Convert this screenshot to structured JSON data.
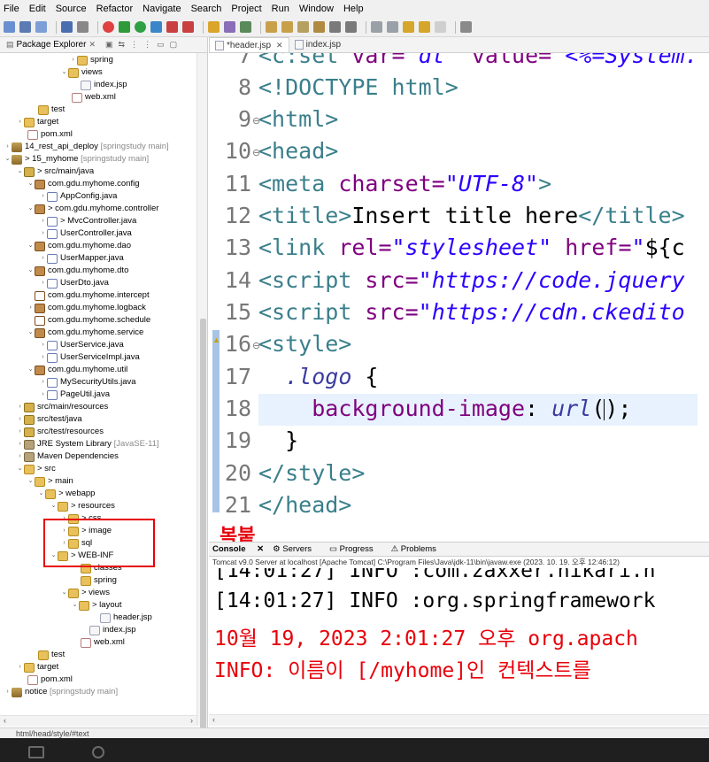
{
  "menu": [
    "File",
    "Edit",
    "Source",
    "Refactor",
    "Navigate",
    "Search",
    "Project",
    "Run",
    "Window",
    "Help"
  ],
  "explorer": {
    "tab_label": "Package Explorer",
    "rows": [
      {
        "label": "spring",
        "extra": ""
      },
      {
        "label": "views",
        "extra": ""
      },
      {
        "label": "index.jsp",
        "extra": ""
      },
      {
        "label": "web.xml",
        "extra": ""
      },
      {
        "label": "test",
        "extra": ""
      },
      {
        "label": "target",
        "extra": ""
      },
      {
        "label": "pom.xml",
        "extra": ""
      },
      {
        "label": "14_rest_api_deploy",
        "extra": "[springstudy main]"
      },
      {
        "label": "> 15_myhome",
        "extra": "[springstudy main]"
      },
      {
        "label": "> src/main/java",
        "extra": ""
      },
      {
        "label": "com.gdu.myhome.config",
        "extra": ""
      },
      {
        "label": "AppConfig.java",
        "extra": ""
      },
      {
        "label": "> com.gdu.myhome.controller",
        "extra": ""
      },
      {
        "label": "> MvcController.java",
        "extra": ""
      },
      {
        "label": "UserController.java",
        "extra": ""
      },
      {
        "label": "com.gdu.myhome.dao",
        "extra": ""
      },
      {
        "label": "UserMapper.java",
        "extra": ""
      },
      {
        "label": "com.gdu.myhome.dto",
        "extra": ""
      },
      {
        "label": "UserDto.java",
        "extra": ""
      },
      {
        "label": "com.gdu.myhome.intercept",
        "extra": ""
      },
      {
        "label": "com.gdu.myhome.logback",
        "extra": ""
      },
      {
        "label": "com.gdu.myhome.schedule",
        "extra": ""
      },
      {
        "label": "com.gdu.myhome.service",
        "extra": ""
      },
      {
        "label": "UserService.java",
        "extra": ""
      },
      {
        "label": "UserServiceImpl.java",
        "extra": ""
      },
      {
        "label": "com.gdu.myhome.util",
        "extra": ""
      },
      {
        "label": "MySecurityUtils.java",
        "extra": ""
      },
      {
        "label": "PageUtil.java",
        "extra": ""
      },
      {
        "label": "src/main/resources",
        "extra": ""
      },
      {
        "label": "src/test/java",
        "extra": ""
      },
      {
        "label": "src/test/resources",
        "extra": ""
      },
      {
        "label": "JRE System Library",
        "extra": "[JavaSE-11]"
      },
      {
        "label": "Maven Dependencies",
        "extra": ""
      },
      {
        "label": "> src",
        "extra": ""
      },
      {
        "label": "> main",
        "extra": ""
      },
      {
        "label": "> webapp",
        "extra": ""
      },
      {
        "label": "> resources",
        "extra": ""
      },
      {
        "label": "> css",
        "extra": ""
      },
      {
        "label": "> image",
        "extra": ""
      },
      {
        "label": "sql",
        "extra": ""
      },
      {
        "label": "> WEB-INF",
        "extra": ""
      },
      {
        "label": "classes",
        "extra": ""
      },
      {
        "label": "spring",
        "extra": ""
      },
      {
        "label": "> views",
        "extra": ""
      },
      {
        "label": "> layout",
        "extra": ""
      },
      {
        "label": "header.jsp",
        "extra": ""
      },
      {
        "label": "index.jsp",
        "extra": ""
      },
      {
        "label": "web.xml",
        "extra": ""
      },
      {
        "label": "test",
        "extra": ""
      },
      {
        "label": "target",
        "extra": ""
      },
      {
        "label": "pom.xml",
        "extra": ""
      },
      {
        "label": "notice",
        "extra": "[springstudy main]"
      }
    ]
  },
  "editor": {
    "tabs": [
      "*header.jsp",
      "index.jsp"
    ],
    "line_numbers": [
      "7",
      "8",
      "9",
      "10",
      "11",
      "12",
      "13",
      "14",
      "15",
      "16",
      "17",
      "18",
      "19",
      "20",
      "21"
    ]
  },
  "console": {
    "tabs": [
      "Console",
      "Servers",
      "Progress",
      "Problems"
    ],
    "header": "Tomcat v9.0 Server at localhost [Apache Tomcat] C:\\Program Files\\Java\\jdk-11\\bin\\javaw.exe  (2023. 10. 19. 오후 12:46:12)",
    "lines": [
      "[14:01:27] INFO :com.zaxxer.hikari.h",
      "[14:01:27] INFO :org.springframework",
      "10월 19, 2023 2:01:27 오후 org.apach",
      "INFO: 이름이 [/myhome]인 컨텍스트를"
    ]
  },
  "annotation": "복붙",
  "status_path": "html/head/style/#text"
}
